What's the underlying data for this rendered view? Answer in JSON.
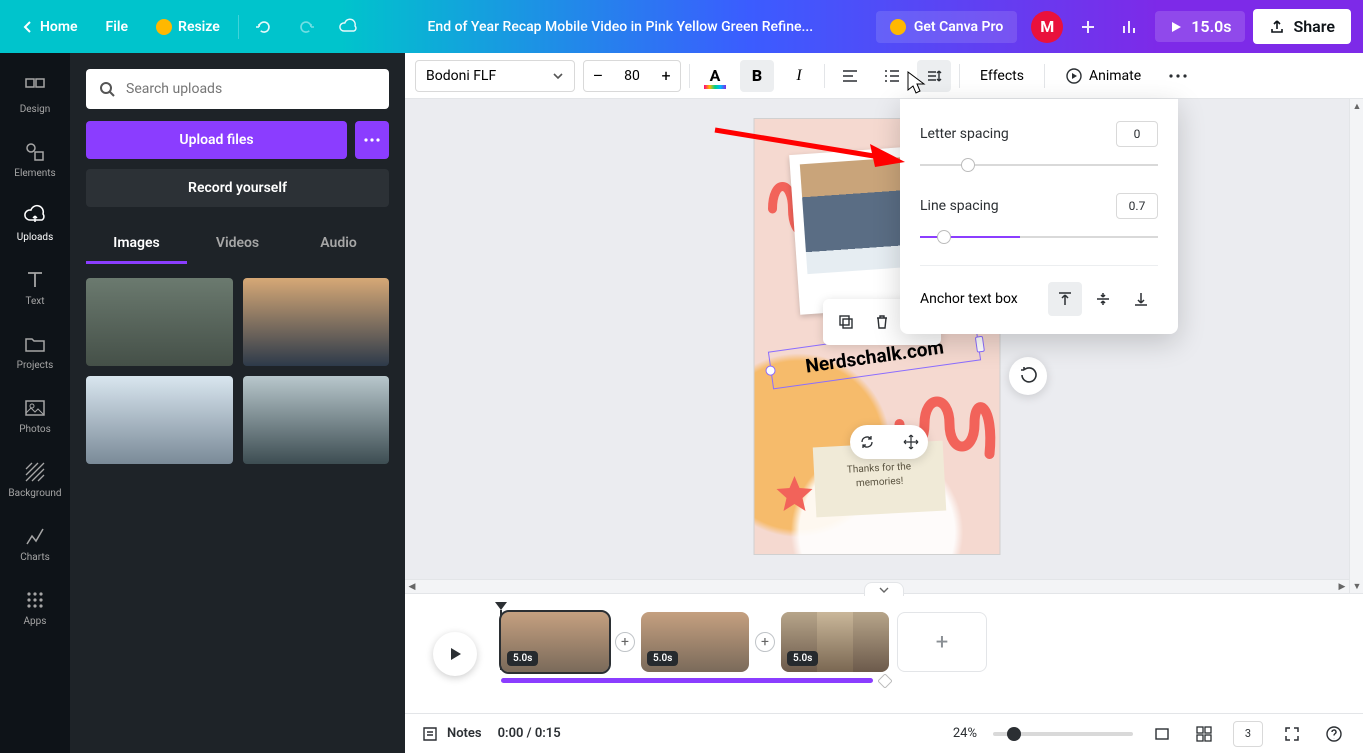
{
  "topbar": {
    "home": "Home",
    "file": "File",
    "resize": "Resize",
    "title": "End of Year Recap Mobile Video in Pink Yellow Green Refine...",
    "get_pro": "Get Canva Pro",
    "avatar_initial": "M",
    "duration": "15.0s",
    "share": "Share"
  },
  "rail": {
    "items": [
      "Design",
      "Elements",
      "Uploads",
      "Text",
      "Projects",
      "Photos",
      "Background",
      "Charts",
      "Apps"
    ],
    "active_index": 2
  },
  "panel": {
    "search_placeholder": "Search uploads",
    "upload": "Upload files",
    "record": "Record yourself",
    "tabs": [
      "Images",
      "Videos",
      "Audio"
    ],
    "active_tab": 0
  },
  "toolbar": {
    "font": "Bodoni FLF",
    "size": "80",
    "effects": "Effects",
    "animate": "Animate"
  },
  "popover": {
    "letter_label": "Letter spacing",
    "letter_value": "0",
    "letter_pos_pct": 20,
    "line_label": "Line spacing",
    "line_value": "0.7",
    "line_pos_pct": 10,
    "line_fill_pct": 42,
    "anchor_label": "Anchor text box"
  },
  "canvas": {
    "text_content": "Nerdschalk.com",
    "note_line1": "Thanks for the",
    "note_line2": "memories!"
  },
  "timeline": {
    "clip_badges": [
      "5.0s",
      "5.0s",
      "5.0s"
    ]
  },
  "status": {
    "notes": "Notes",
    "time": "0:00 / 0:15",
    "zoom": "24%",
    "zoom_pos_pct": 10,
    "page_count": "3"
  }
}
